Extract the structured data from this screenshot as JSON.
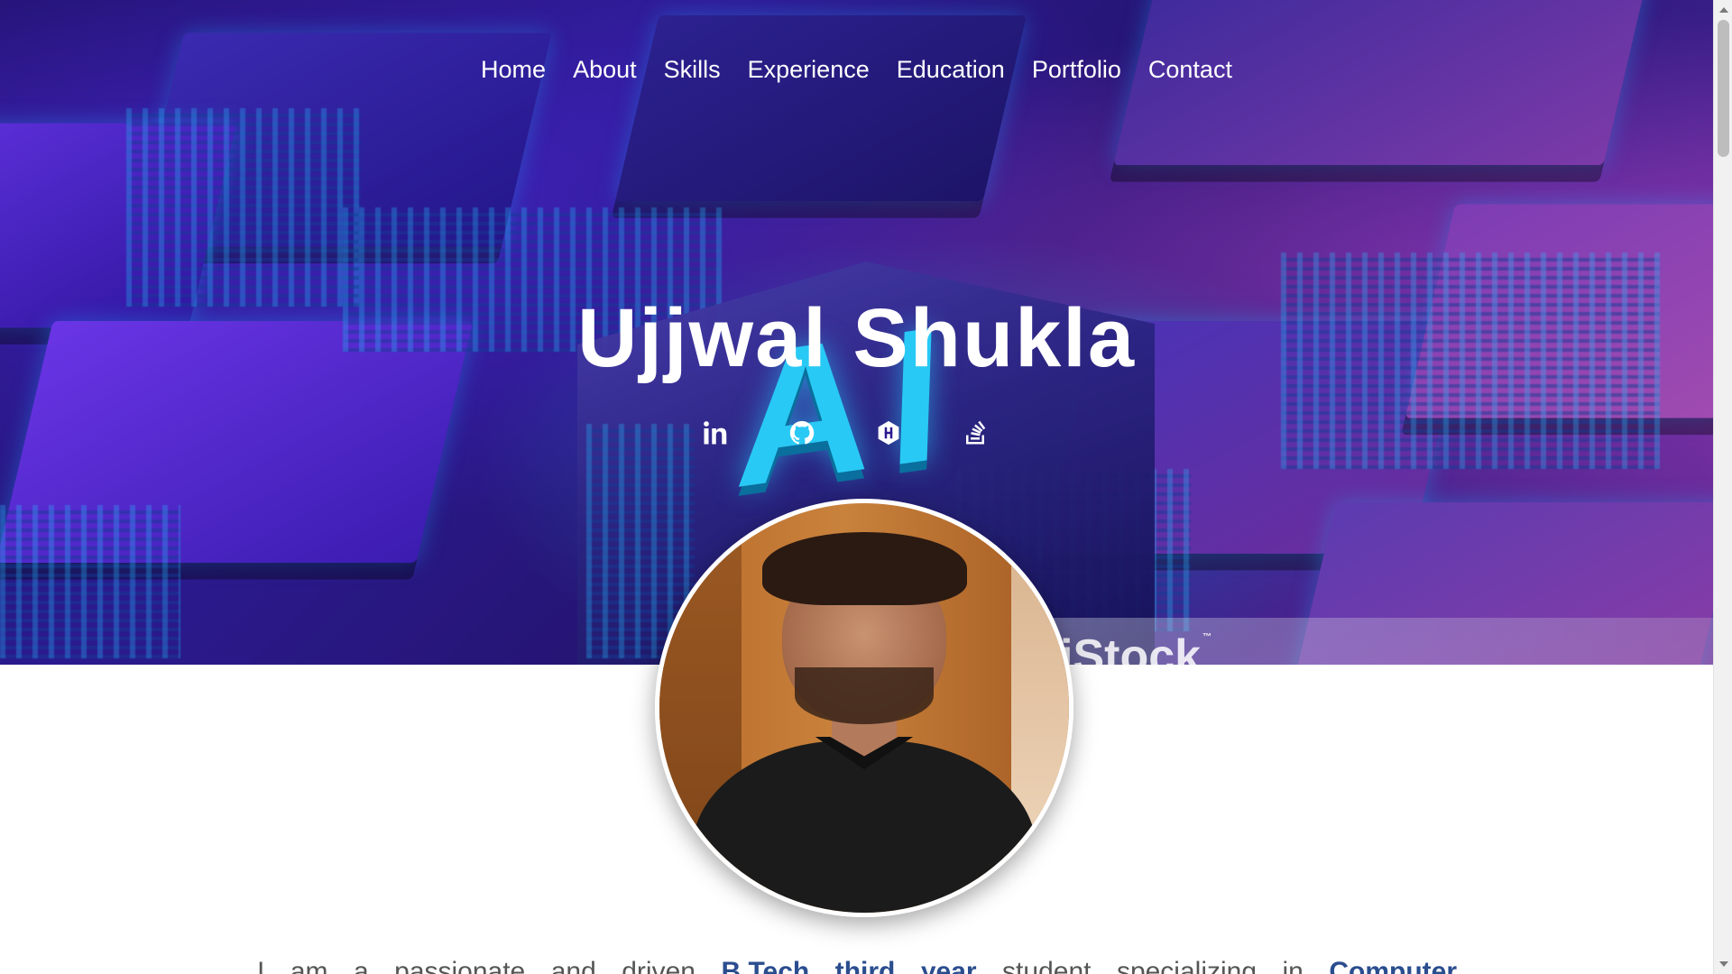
{
  "nav": {
    "items": [
      {
        "label": "Home"
      },
      {
        "label": "About"
      },
      {
        "label": "Skills"
      },
      {
        "label": "Experience"
      },
      {
        "label": "Education"
      },
      {
        "label": "Portfolio"
      },
      {
        "label": "Contact"
      }
    ]
  },
  "hero": {
    "title": "Ujjwal Shukla",
    "background_text": "AI",
    "watermark": "iStock",
    "watermark_tm": "™"
  },
  "socials": [
    {
      "icon": "linkedin-icon"
    },
    {
      "icon": "github-icon"
    },
    {
      "icon": "hackerrank-icon"
    },
    {
      "icon": "stackoverflow-icon"
    }
  ],
  "intro": {
    "part1": "I am a passionate and driven ",
    "highlight1": "B.Tech third year",
    "part2": " student specializing in ",
    "highlight2": "Computer"
  },
  "colors": {
    "accent": "#2a4d8f",
    "hero_primary": "#2b1a8f",
    "hero_glow": "#29c9f5"
  }
}
